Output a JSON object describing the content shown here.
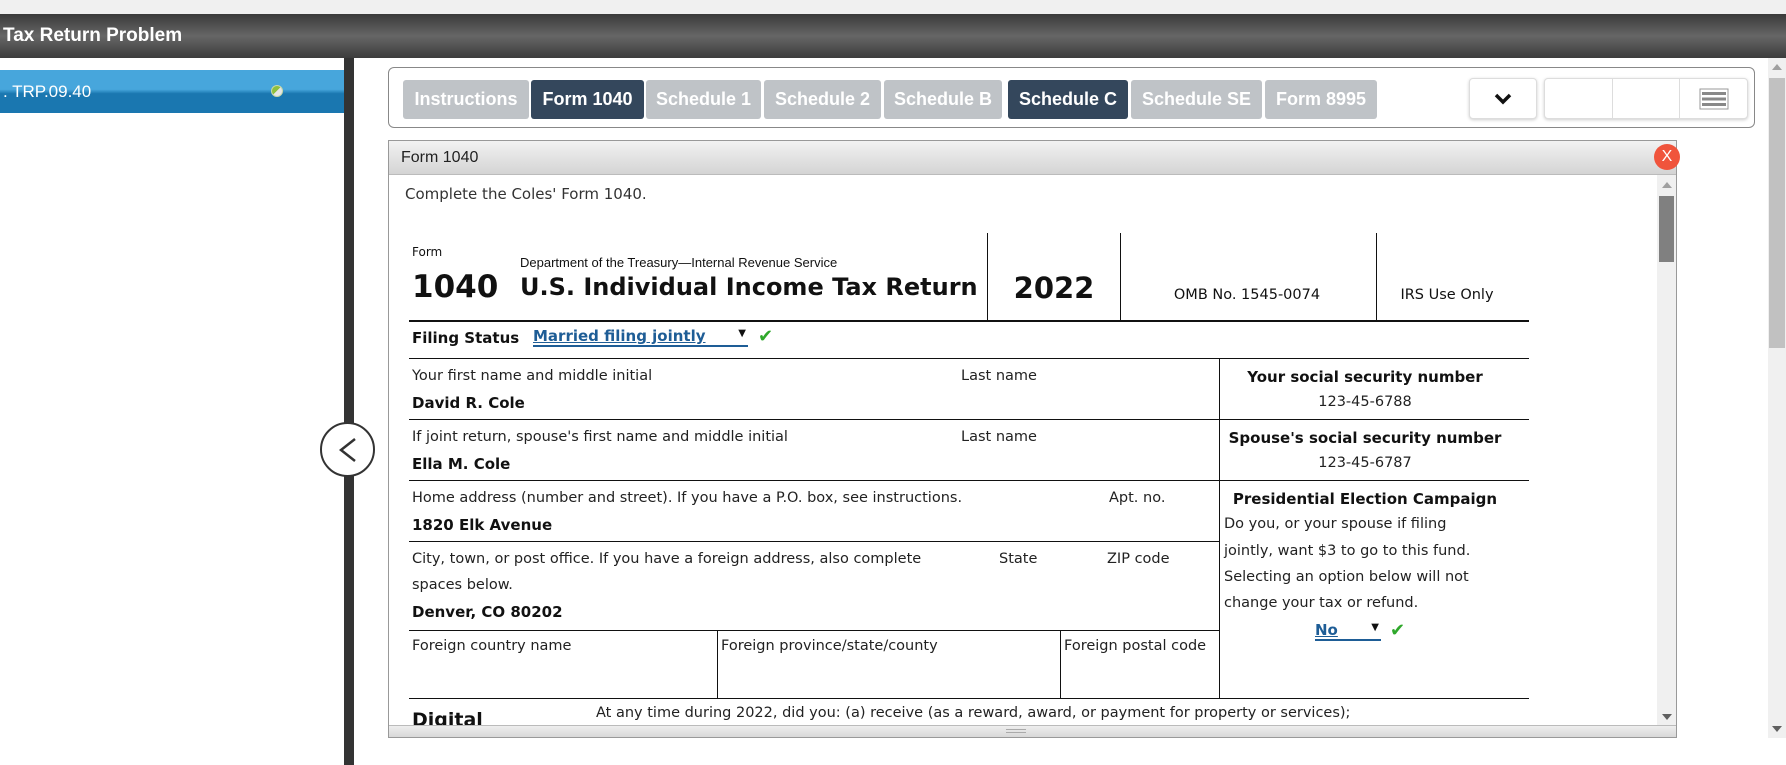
{
  "app": {
    "title": "Tax Return Problem"
  },
  "sidebar": {
    "items": [
      {
        "label": ". TRP.09.40",
        "status": "partial"
      }
    ]
  },
  "toolbar": {
    "tabs": [
      {
        "label": "Instructions",
        "active": false
      },
      {
        "label": "Form 1040",
        "active": true
      },
      {
        "label": "Schedule 1",
        "active": false
      },
      {
        "label": "Schedule 2",
        "active": false
      },
      {
        "label": "Schedule B",
        "active": false
      },
      {
        "label": "Schedule C",
        "active": true
      },
      {
        "label": "Schedule SE",
        "active": false
      },
      {
        "label": "Form 8995",
        "active": false
      }
    ],
    "dropdown_icon": "chevron-down-icon",
    "menu_icon": "hamburger-menu-icon"
  },
  "panel": {
    "title": "Form 1040",
    "close_label": "X",
    "instruction": "Complete the Coles' Form 1040."
  },
  "form": {
    "form_label": "Form",
    "form_number": "1040",
    "department": "Department of the Treasury—Internal Revenue Service",
    "title": "U.S. Individual Income Tax Return",
    "year": "2022",
    "omb": "OMB No. 1545-0074",
    "irs_use": "IRS Use Only",
    "filing_status": {
      "label": "Filing Status",
      "value": "Married filing jointly",
      "validated": true
    },
    "first_name": {
      "label": "Your first name and middle initial",
      "value": "David R. Cole"
    },
    "last_name_label": "Last name",
    "ssn": {
      "label": "Your social security number",
      "value": "123-45-6788"
    },
    "spouse_first_name": {
      "label": "If joint return, spouse's first name and middle initial",
      "value": "Ella M. Cole"
    },
    "spouse_last_name_label": "Last name",
    "spouse_ssn": {
      "label": "Spouse's social security number",
      "value": "123-45-6787"
    },
    "home_address": {
      "label": "Home address (number and street). If you have a P.O. box, see instructions.",
      "value": "1820 Elk Avenue"
    },
    "apt_label": "Apt. no.",
    "city": {
      "label_line1": "City, town, or post office. If you have a foreign address, also complete",
      "label_line2": "spaces below.",
      "value": "Denver, CO 80202"
    },
    "state_label": "State",
    "zip_label": "ZIP code",
    "presidential": {
      "title": "Presidential Election Campaign",
      "lines": [
        "Do you, or your spouse if filing",
        "jointly, want $3 to go to this fund.",
        "Selecting an option below will not",
        "change your tax or refund."
      ],
      "value": "No",
      "validated": true
    },
    "foreign_country_label": "Foreign country name",
    "foreign_province_label": "Foreign province/state/county",
    "foreign_postal_label": "Foreign postal code",
    "digital_label": "Digital",
    "digital_question": "At any time during 2022, did you: (a) receive (as a reward, award, or payment for property or services);"
  }
}
